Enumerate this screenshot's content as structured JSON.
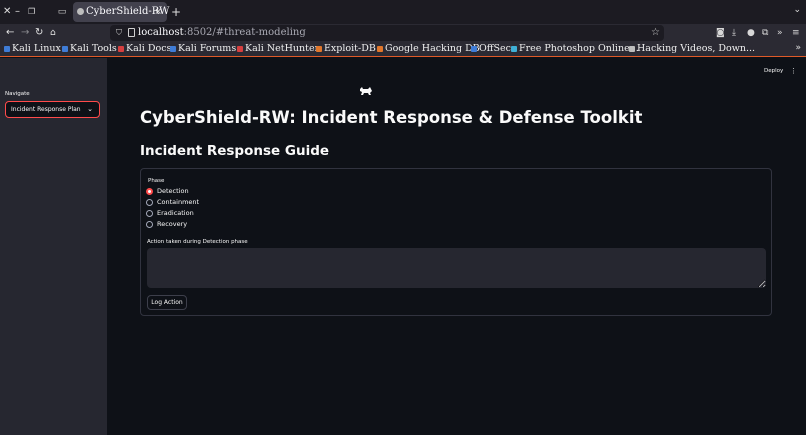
{
  "browser": {
    "window_controls": [
      "✕",
      "–",
      "❐"
    ],
    "tab": {
      "title": "CyberShield-RW",
      "close": "×"
    },
    "new_tab": "+",
    "url_host": "localhost",
    "url_path": ":8502/#threat-modeling",
    "bookmarks": [
      {
        "label": "Kali Linux",
        "color": "#3f7cd6"
      },
      {
        "label": "Kali Tools",
        "color": "#3f7cd6"
      },
      {
        "label": "Kali Docs",
        "color": "#d63f3f"
      },
      {
        "label": "Kali Forums",
        "color": "#3f7cd6"
      },
      {
        "label": "Kali NetHunter",
        "color": "#d63f3f"
      },
      {
        "label": "Exploit-DB",
        "color": "#e0762b"
      },
      {
        "label": "Google Hacking DB",
        "color": "#e0762b"
      },
      {
        "label": "OffSec",
        "color": "#3f7cd6"
      },
      {
        "label": "Free Photoshop Online...",
        "color": "#3fb0d6"
      },
      {
        "label": "Hacking Videos, Down...",
        "color": "#bdbdbd"
      }
    ]
  },
  "sidebar": {
    "nav_label": "Navigate",
    "selected": "Incident Response Plan"
  },
  "header": {
    "deploy": "Deploy"
  },
  "main": {
    "title": "CyberShield-RW: Incident Response & Defense Toolkit",
    "section": "Incident Response Guide",
    "phase_label": "Phase",
    "phases": [
      "Detection",
      "Containment",
      "Eradication",
      "Recovery"
    ],
    "selected_phase": "Detection",
    "action_label": "Action taken during Detection phase",
    "log_button": "Log Action"
  },
  "colors": {
    "accent": "#ff4b4b",
    "sidebar_bg": "#262730",
    "main_bg": "#0e1117"
  }
}
